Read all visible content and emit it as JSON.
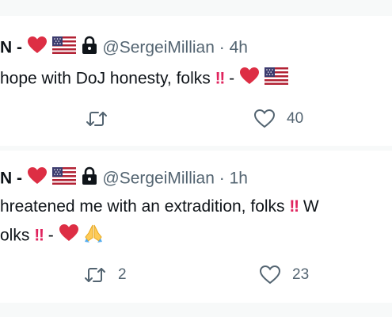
{
  "tweets": [
    {
      "name": "N -",
      "handle": "@SergeiMillian",
      "dot": "·",
      "time": "4h",
      "lines": [
        {
          "text": "hope with DoJ honesty, folks",
          "tail": "-"
        }
      ],
      "retweets": "",
      "likes": "40"
    },
    {
      "name": "N -",
      "handle": "@SergeiMillian",
      "dot": "·",
      "time": "1h",
      "line1": "hreatened me with an extradition, folks",
      "line1_tail": "W",
      "line2": "olks",
      "line2_tail": "-",
      "retweets": "2",
      "likes": "23"
    }
  ],
  "excl": "‼",
  "colors": {
    "heart": "#e0245e",
    "muted": "#536471",
    "text": "#0f1419"
  },
  "icons": [
    "red-heart-emoji",
    "us-flag-emoji",
    "lock-icon",
    "retweet-icon",
    "like-icon",
    "folded-hands-emoji"
  ]
}
